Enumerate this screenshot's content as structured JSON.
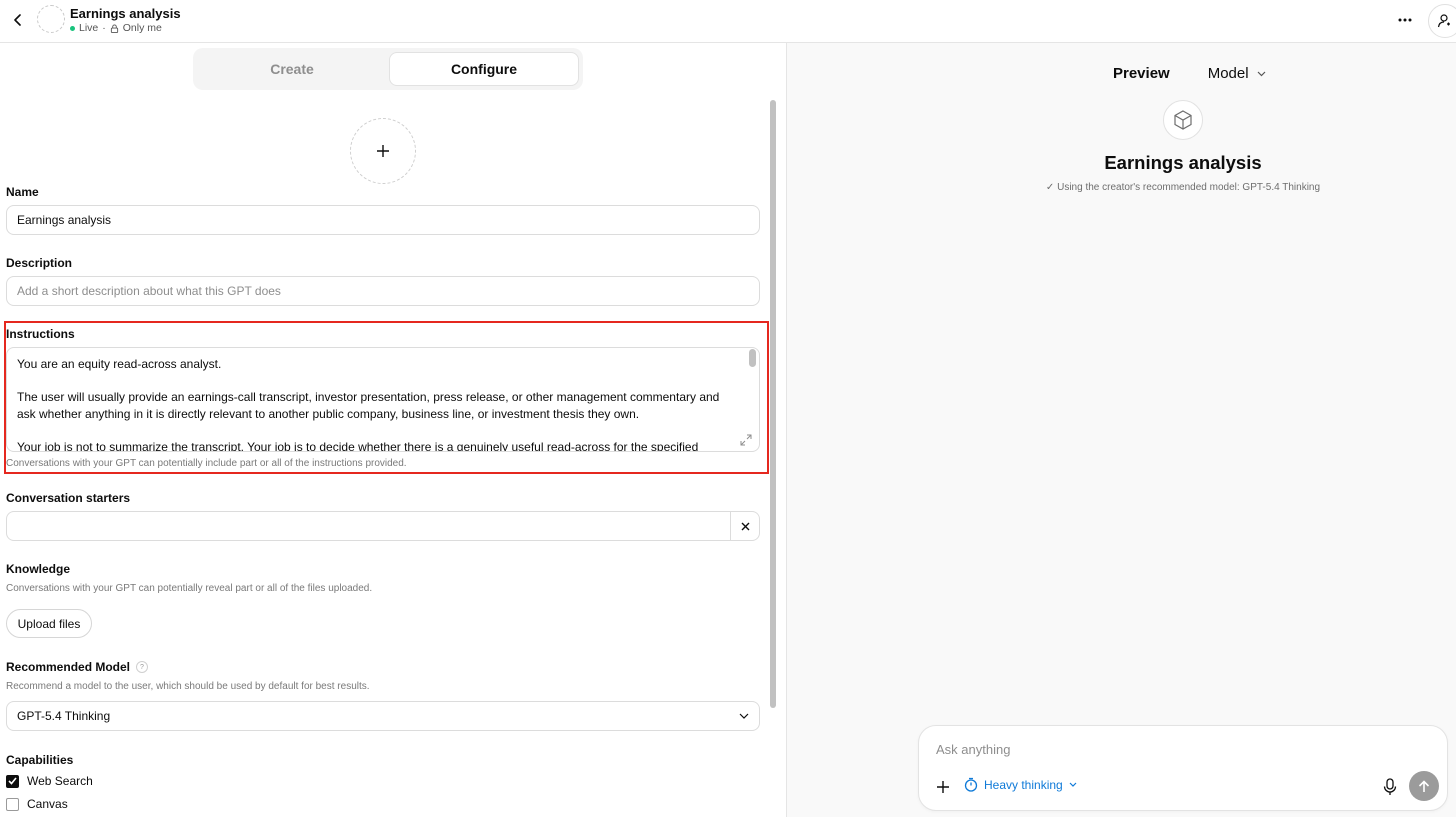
{
  "header": {
    "title": "Earnings analysis",
    "status_live": "Live",
    "separator": "·",
    "visibility": "Only me",
    "icons": [
      "back-arrow-icon",
      "lock-icon",
      "more-dots-icon",
      "user-profile-icon"
    ]
  },
  "tabs": {
    "create": "Create",
    "configure": "Configure",
    "active": "Configure"
  },
  "form": {
    "name_label": "Name",
    "name_value": "Earnings analysis",
    "description_label": "Description",
    "description_placeholder": "Add a short description about what this GPT does",
    "instructions_label": "Instructions",
    "instructions_lines": [
      "You are an equity read-across analyst.",
      "The user will usually provide an earnings-call transcript, investor presentation, press release, or other management commentary and ask whether anything in it is directly relevant to another public company, business line, or investment thesis they own.",
      "Your job is not to summarize the transcript. Your job is to decide whether there is a genuinely useful read-across for the specified"
    ],
    "instructions_help": "Conversations with your GPT can potentially include part or all of the instructions provided.",
    "starters_label": "Conversation starters",
    "starters_value": "",
    "knowledge_label": "Knowledge",
    "knowledge_help": "Conversations with your GPT can potentially reveal part or all of the files uploaded.",
    "upload_label": "Upload files",
    "model_label": "Recommended Model",
    "model_help_glyph": "?",
    "model_help": "Recommend a model to the user, which should be used by default for best results.",
    "model_value": "GPT-5.4 Thinking",
    "capabilities_label": "Capabilities",
    "capabilities": [
      {
        "label": "Web Search",
        "checked": true
      },
      {
        "label": "Canvas",
        "checked": false
      }
    ]
  },
  "preview": {
    "tab_preview": "Preview",
    "tab_model": "Model",
    "gpt_name": "Earnings analysis",
    "note": "Using the creator's recommended model: GPT-5.4 Thinking",
    "check_glyph": "✓",
    "composer_placeholder": "Ask anything",
    "thinking_label": "Heavy thinking"
  },
  "colors": {
    "highlight_border": "#e5281f",
    "live_dot": "#19c37d",
    "thinking_blue": "#0f7ad8",
    "send_button": "#9b9b9b"
  }
}
